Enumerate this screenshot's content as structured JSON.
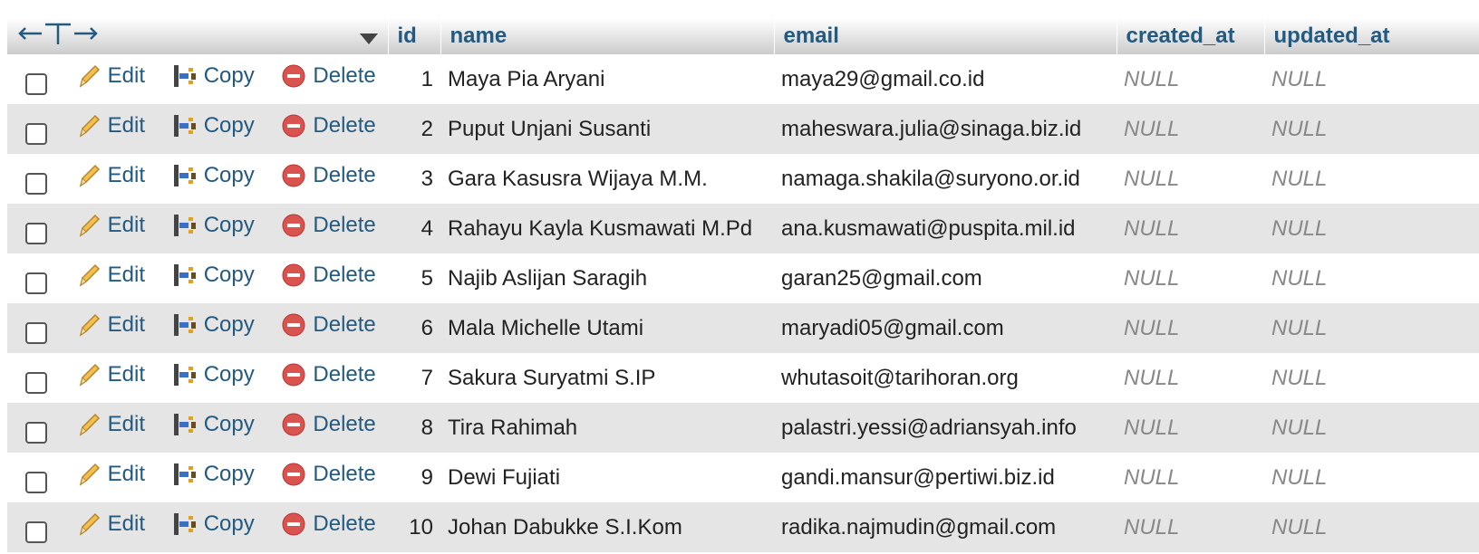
{
  "header": {
    "col_id": "id",
    "col_name": "name",
    "col_email": "email",
    "col_created": "created_at",
    "col_updated": "updated_at"
  },
  "actions": {
    "edit": "Edit",
    "copy": "Copy",
    "delete": "Delete"
  },
  "rows": [
    {
      "id": "1",
      "name": "Maya Pia Aryani",
      "email": "maya29@gmail.co.id",
      "created_at": "NULL",
      "updated_at": "NULL"
    },
    {
      "id": "2",
      "name": "Puput Unjani Susanti",
      "email": "maheswara.julia@sinaga.biz.id",
      "created_at": "NULL",
      "updated_at": "NULL"
    },
    {
      "id": "3",
      "name": "Gara Kasusra Wijaya M.M.",
      "email": "namaga.shakila@suryono.or.id",
      "created_at": "NULL",
      "updated_at": "NULL"
    },
    {
      "id": "4",
      "name": "Rahayu Kayla Kusmawati M.Pd",
      "email": "ana.kusmawati@puspita.mil.id",
      "created_at": "NULL",
      "updated_at": "NULL"
    },
    {
      "id": "5",
      "name": "Najib Aslijan Saragih",
      "email": "garan25@gmail.com",
      "created_at": "NULL",
      "updated_at": "NULL"
    },
    {
      "id": "6",
      "name": "Mala Michelle Utami",
      "email": "maryadi05@gmail.com",
      "created_at": "NULL",
      "updated_at": "NULL"
    },
    {
      "id": "7",
      "name": "Sakura Suryatmi S.IP",
      "email": "whutasoit@tarihoran.org",
      "created_at": "NULL",
      "updated_at": "NULL"
    },
    {
      "id": "8",
      "name": "Tira Rahimah",
      "email": "palastri.yessi@adriansyah.info",
      "created_at": "NULL",
      "updated_at": "NULL"
    },
    {
      "id": "9",
      "name": "Dewi Fujiati",
      "email": "gandi.mansur@pertiwi.biz.id",
      "created_at": "NULL",
      "updated_at": "NULL"
    },
    {
      "id": "10",
      "name": "Johan Dabukke S.I.Kom",
      "email": "radika.najmudin@gmail.com",
      "created_at": "NULL",
      "updated_at": "NULL"
    }
  ],
  "icons": {
    "column_resize": "left-right-arrows-icon",
    "sort": "triangle-down-icon",
    "edit": "pencil-icon",
    "copy": "copy-icon",
    "delete": "delete-circle-icon"
  },
  "colors": {
    "link": "#235a81",
    "null_text": "#888888",
    "row_alt": "#e5e5e5",
    "delete_red": "#d9534f"
  }
}
